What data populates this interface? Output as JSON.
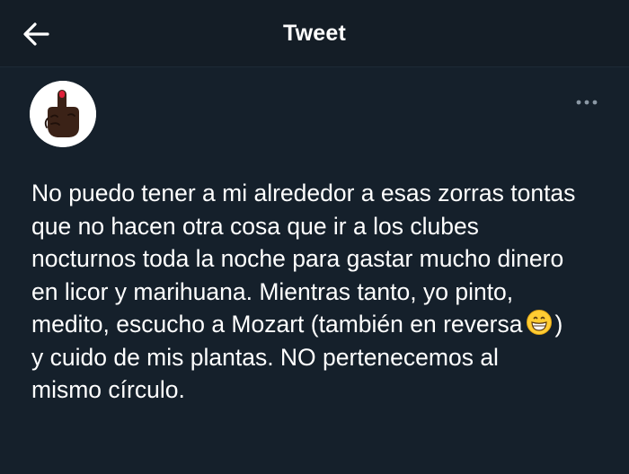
{
  "header": {
    "title": "Tweet",
    "back_icon": "arrow-left-icon"
  },
  "tweet": {
    "avatar_icon": "middle-finger-emoji-avatar",
    "more_icon": "more-horizontal-icon",
    "text_before_emoji": "No puedo tener a mi alrededor a esas zorras tontas\nque no hacen otra cosa que ir a los clubes\nnocturnos toda la noche para gastar mucho dinero\nen licor y marihuana. Mientras tanto, yo pinto,\nmedito, escucho a Mozart (también en reversa",
    "emoji": "grinning-face-emoji",
    "text_after_emoji": ")\ny cuido de mis plantas. NO pertenecemos al\nmismo círculo."
  },
  "colors": {
    "background": "#15202b",
    "header_background": "#141d26",
    "text": "#ffffff",
    "muted_icon": "#8b98a5"
  }
}
